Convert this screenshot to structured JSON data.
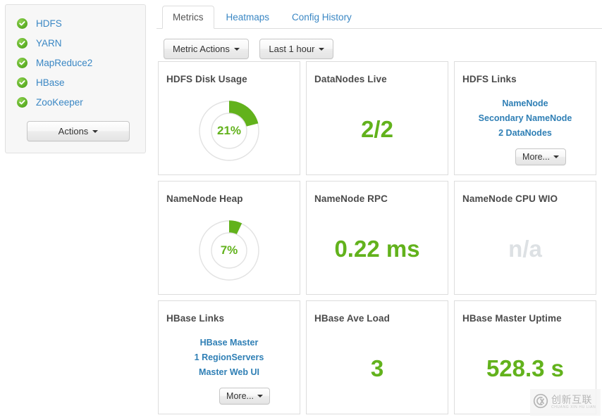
{
  "sidebar": {
    "services": [
      {
        "name": "HDFS",
        "status": "ok"
      },
      {
        "name": "YARN",
        "status": "ok"
      },
      {
        "name": "MapReduce2",
        "status": "ok"
      },
      {
        "name": "HBase",
        "status": "ok"
      },
      {
        "name": "ZooKeeper",
        "status": "ok"
      }
    ],
    "actions_button": "Actions"
  },
  "tabs": [
    {
      "label": "Metrics",
      "active": true
    },
    {
      "label": "Heatmaps",
      "active": false
    },
    {
      "label": "Config History",
      "active": false
    }
  ],
  "toolbar": {
    "metric_actions": "Metric Actions",
    "time_range": "Last 1 hour"
  },
  "cards": {
    "hdfs_disk_usage": {
      "title": "HDFS Disk Usage",
      "value": "21%",
      "percent": 21
    },
    "datanodes_live": {
      "title": "DataNodes Live",
      "value": "2/2"
    },
    "hdfs_links": {
      "title": "HDFS Links",
      "links": [
        "NameNode",
        "Secondary NameNode",
        "2 DataNodes"
      ],
      "more_button": "More..."
    },
    "namenode_heap": {
      "title": "NameNode Heap",
      "value": "7%",
      "percent": 7
    },
    "namenode_rpc": {
      "title": "NameNode RPC",
      "value": "0.22 ms"
    },
    "namenode_cpu_wio": {
      "title": "NameNode CPU WIO",
      "value": "n/a"
    },
    "hbase_links": {
      "title": "HBase Links",
      "links": [
        "HBase Master",
        "1 RegionServers",
        "Master Web UI"
      ],
      "more_button": "More..."
    },
    "hbase_ave_load": {
      "title": "HBase Ave Load",
      "value": "3"
    },
    "hbase_master_uptime": {
      "title": "HBase Master Uptime",
      "value": "528.3 s"
    }
  },
  "watermark": {
    "cn": "创新互联",
    "en": "CHUANG XIN HU LIAN"
  },
  "colors": {
    "green": "#62b21c",
    "link_blue": "#3a87c4",
    "card_link_blue": "#2f7fb5",
    "na_gray": "#dde1e4",
    "status_green": "#5cae25"
  }
}
